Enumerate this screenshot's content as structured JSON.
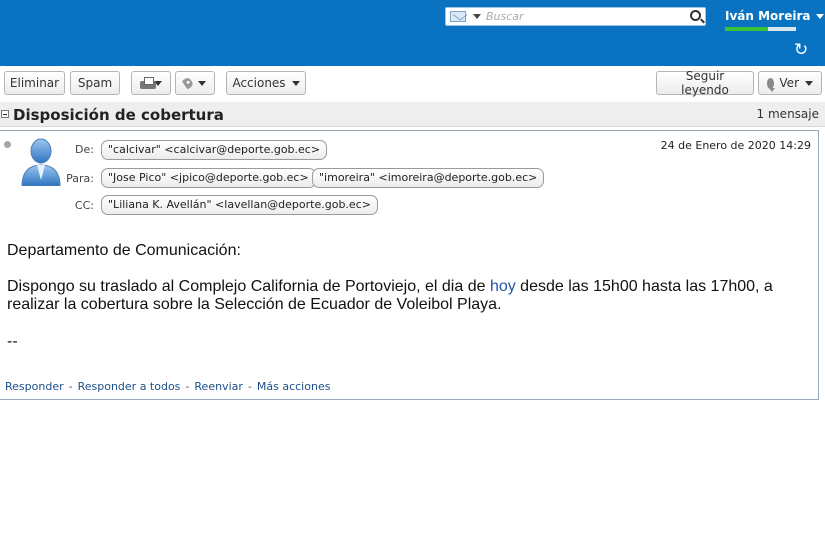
{
  "header": {
    "search_placeholder": "Buscar",
    "user_name": "Iván Moreira",
    "quota_fraction": 0.6
  },
  "toolbar": {
    "delete_label": "Eliminar",
    "spam_label": "Spam",
    "actions_label": "Acciones",
    "continue_reading_label": "Seguir leyendo",
    "view_label": "Ver"
  },
  "thread": {
    "subject": "Disposición de cobertura",
    "count": "1 mensaje"
  },
  "message": {
    "date": "24 de Enero de 2020 14:29",
    "from_label": "De:",
    "to_label": "Para:",
    "cc_label": "CC:",
    "from": "\"calcivar\" <calcivar@deporte.gob.ec>",
    "to": [
      "\"Jose Pico\" <jpico@deporte.gob.ec>",
      "\"imoreira\" <imoreira@deporte.gob.ec>"
    ],
    "cc": [
      "\"Liliana K. Avellán\" <lavellan@deporte.gob.ec>"
    ],
    "body": {
      "greeting": "Departamento de Comunicación:",
      "line1_a": "Dispongo su traslado al Complejo California de Portoviejo, el dia de ",
      "line1_link": "hoy",
      "line1_b": " desde las 15h00 hasta las 17h00, a",
      "line2": "realizar la cobertura sobre la Selección de Ecuador de Voleibol Playa.",
      "signature": "--"
    },
    "actions": {
      "reply": "Responder",
      "reply_all": "Responder a todos",
      "forward": "Reenviar",
      "more": "Más acciones"
    }
  },
  "colors": {
    "header_blue": "#0a73c1",
    "quota_green": "#3ac43a",
    "link_blue": "#1c4f88"
  }
}
